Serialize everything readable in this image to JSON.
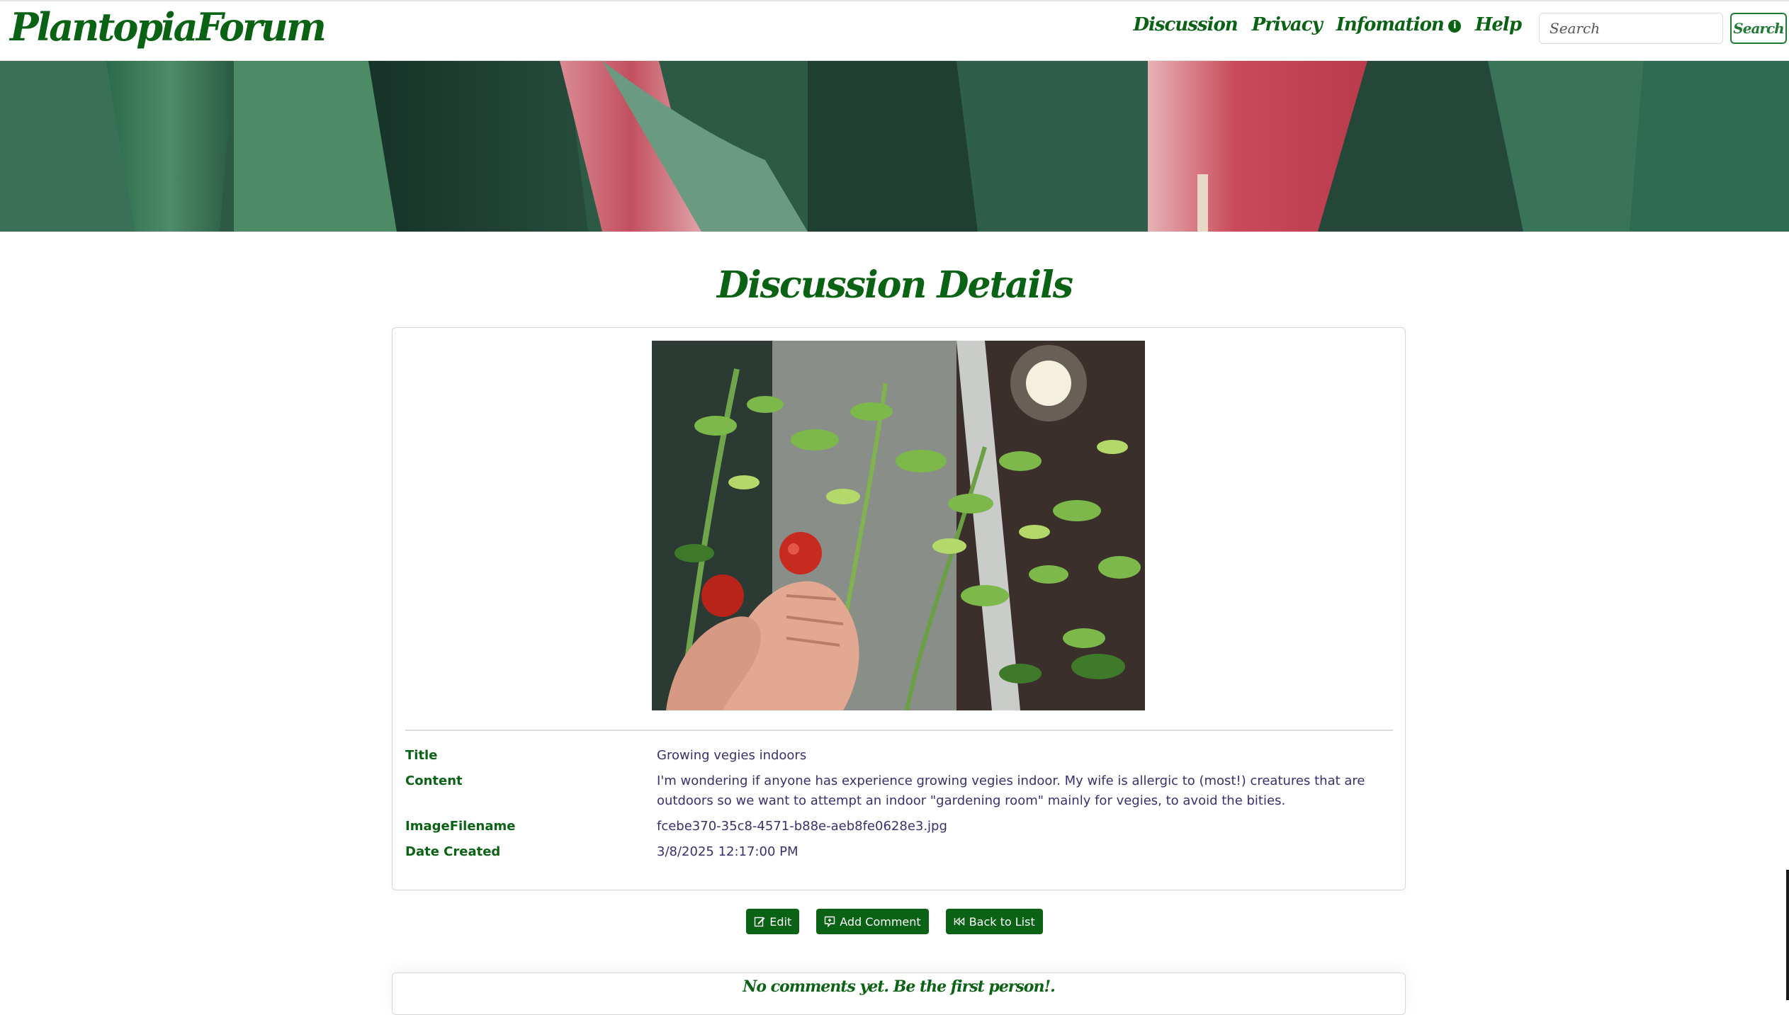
{
  "brand": "PlantopiaForum",
  "nav": {
    "discussion": "Discussion",
    "privacy": "Privacy",
    "information": "Infomation",
    "info_badge": "i",
    "help": "Help"
  },
  "search": {
    "placeholder": "Search",
    "button_label": "Search"
  },
  "page_title": "Discussion Details",
  "details": {
    "title_label": "Title",
    "title_value": "Growing vegies indoors",
    "content_label": "Content",
    "content_value": "I'm wondering if anyone has experience growing vegies indoor. My wife is allergic to (most!) creatures that are outdoors so we want to attempt an indoor \"gardening room\" mainly for vegies, to avoid the bities.",
    "image_label": "ImageFilename",
    "image_value": "fcebe370-35c8-4571-b88e-aeb8fe0628e3.jpg",
    "date_label": "Date Created",
    "date_value": "3/8/2025 12:17:00 PM"
  },
  "actions": {
    "edit": "Edit",
    "add_comment": "Add Comment",
    "back": "Back to List"
  },
  "comments": {
    "empty_message": "No comments yet. Be the first person!."
  },
  "colors": {
    "brand_green": "#0a6314",
    "value_text": "#3c2f6e"
  }
}
